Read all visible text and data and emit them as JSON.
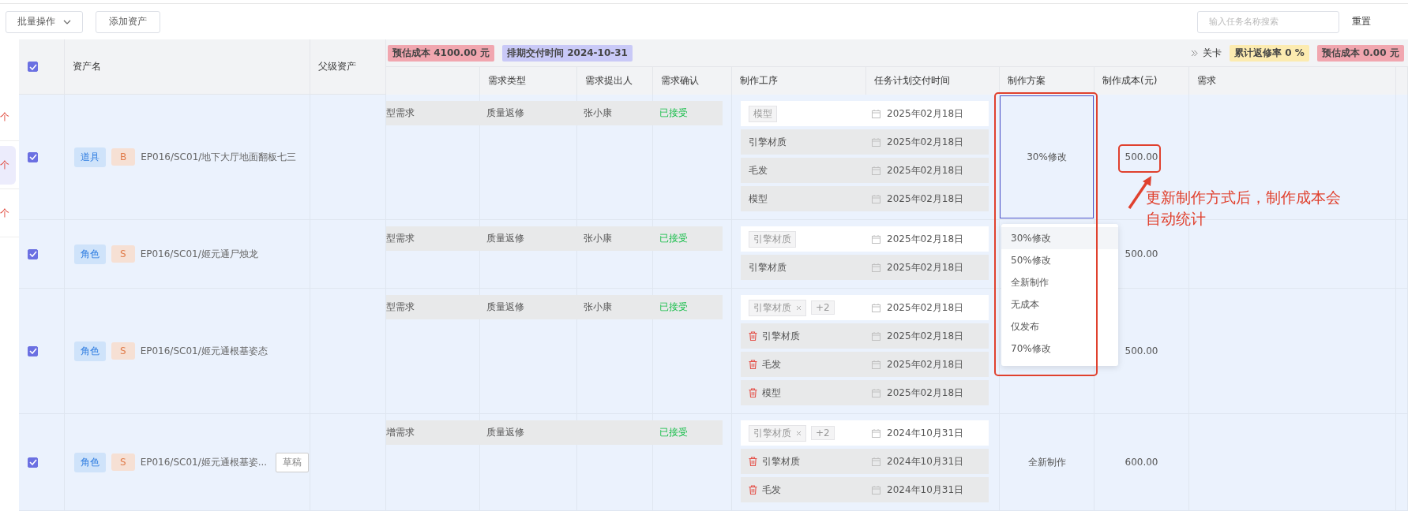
{
  "toolbar": {
    "batch_button": "批量操作",
    "add_button": "添加资产",
    "search": {
      "placeholder": "输入任务名称搜索"
    },
    "reset_button": "重置"
  },
  "side_strip": [
    {
      "text": "个",
      "selected": false
    },
    {
      "text": "个",
      "selected": true
    },
    {
      "text": "个",
      "selected": false
    }
  ],
  "table": {
    "select_all_checked": true,
    "summary_left": [
      {
        "text": "预估成本 4100.00 元",
        "kind": "cost"
      },
      {
        "text": "排期交付时间 2024-10-31",
        "kind": "schedule"
      }
    ],
    "summary_right": {
      "link": "关卡",
      "tags": [
        {
          "text": "累计返修率 0 %",
          "kind": "rate"
        },
        {
          "text": "预估成本 0.00 元",
          "kind": "cost"
        }
      ]
    },
    "columns": [
      "资产名",
      "父级资产",
      "需求类型",
      "需求提出人",
      "需求确认",
      "制作工序",
      "任务计划交付时间",
      "制作方案",
      "制作成本(元)",
      "需求"
    ],
    "rows": [
      {
        "checked": true,
        "type": "道具",
        "grade": "B",
        "name": "EP016/SC01/地下大厅地面翻板七三",
        "needs": {
          "requirement": "型需求",
          "type": "质量返修",
          "requester": "张小康",
          "status": "已接受"
        },
        "processes": [
          {
            "kind": "select",
            "tags": [
              {
                "text": "模型",
                "removable": false
              }
            ],
            "date": "2025年02月18日"
          },
          {
            "kind": "item",
            "name": "引擎材质",
            "deletable": false,
            "date": "2025年02月18日"
          },
          {
            "kind": "item",
            "name": "毛发",
            "deletable": false,
            "date": "2025年02月18日"
          },
          {
            "kind": "item",
            "name": "模型",
            "deletable": false,
            "date": "2025年02月18日"
          }
        ],
        "scheme": "30%修改",
        "scheme_selected": true,
        "cost": "500.00"
      },
      {
        "checked": true,
        "type": "角色",
        "grade": "S",
        "name": "EP016/SC01/姬元通尸烛龙",
        "needs": {
          "requirement": "型需求",
          "type": "质量返修",
          "requester": "张小康",
          "status": "已接受"
        },
        "processes": [
          {
            "kind": "select",
            "tags": [
              {
                "text": "引擎材质",
                "removable": false
              }
            ],
            "date": "2025年02月18日"
          },
          {
            "kind": "item",
            "name": "引擎材质",
            "deletable": false,
            "date": "2025年02月18日"
          }
        ],
        "scheme_selected": false,
        "cost": "500.00"
      },
      {
        "checked": true,
        "type": "角色",
        "grade": "S",
        "name": "EP016/SC01/姬元通根基姿态",
        "needs": {
          "requirement": "型需求",
          "type": "质量返修",
          "requester": "张小康",
          "status": "已接受"
        },
        "processes": [
          {
            "kind": "select",
            "tags": [
              {
                "text": "引擎材质",
                "removable": true
              },
              {
                "text": "+2",
                "removable": false
              }
            ],
            "date": "2025年02月18日"
          },
          {
            "kind": "item",
            "name": "引擎材质",
            "deletable": true,
            "date": "2025年02月18日"
          },
          {
            "kind": "item",
            "name": "毛发",
            "deletable": true,
            "date": "2025年02月18日"
          },
          {
            "kind": "item",
            "name": "模型",
            "deletable": true,
            "date": "2025年02月18日"
          }
        ],
        "scheme_selected": false,
        "cost": "500.00"
      },
      {
        "checked": true,
        "type": "角色",
        "grade": "S",
        "name": "EP016/SC01/姬元通根基姿...",
        "draft": "草稿",
        "needs": {
          "requirement": "增需求",
          "type": "质量返修",
          "status": "已接受"
        },
        "processes": [
          {
            "kind": "select",
            "tags": [
              {
                "text": "引擎材质",
                "removable": true
              },
              {
                "text": "+2",
                "removable": false
              }
            ],
            "date": "2024年10月31日"
          },
          {
            "kind": "item",
            "name": "引擎材质",
            "deletable": true,
            "date": "2024年10月31日"
          },
          {
            "kind": "item",
            "name": "毛发",
            "deletable": true,
            "date": "2024年10月31日"
          }
        ],
        "scheme": "全新制作",
        "scheme_selected": false,
        "cost": "600.00"
      }
    ]
  },
  "dropdown": {
    "options": [
      {
        "label": "30%修改",
        "selected": true
      },
      {
        "label": "50%修改",
        "selected": false
      },
      {
        "label": "全新制作",
        "selected": false
      },
      {
        "label": "无成本",
        "selected": false
      },
      {
        "label": "仅发布",
        "selected": false
      },
      {
        "label": "70%修改",
        "selected": false
      }
    ]
  },
  "annotation": {
    "text": "更新制作方式后，制作成本会自动统计"
  }
}
